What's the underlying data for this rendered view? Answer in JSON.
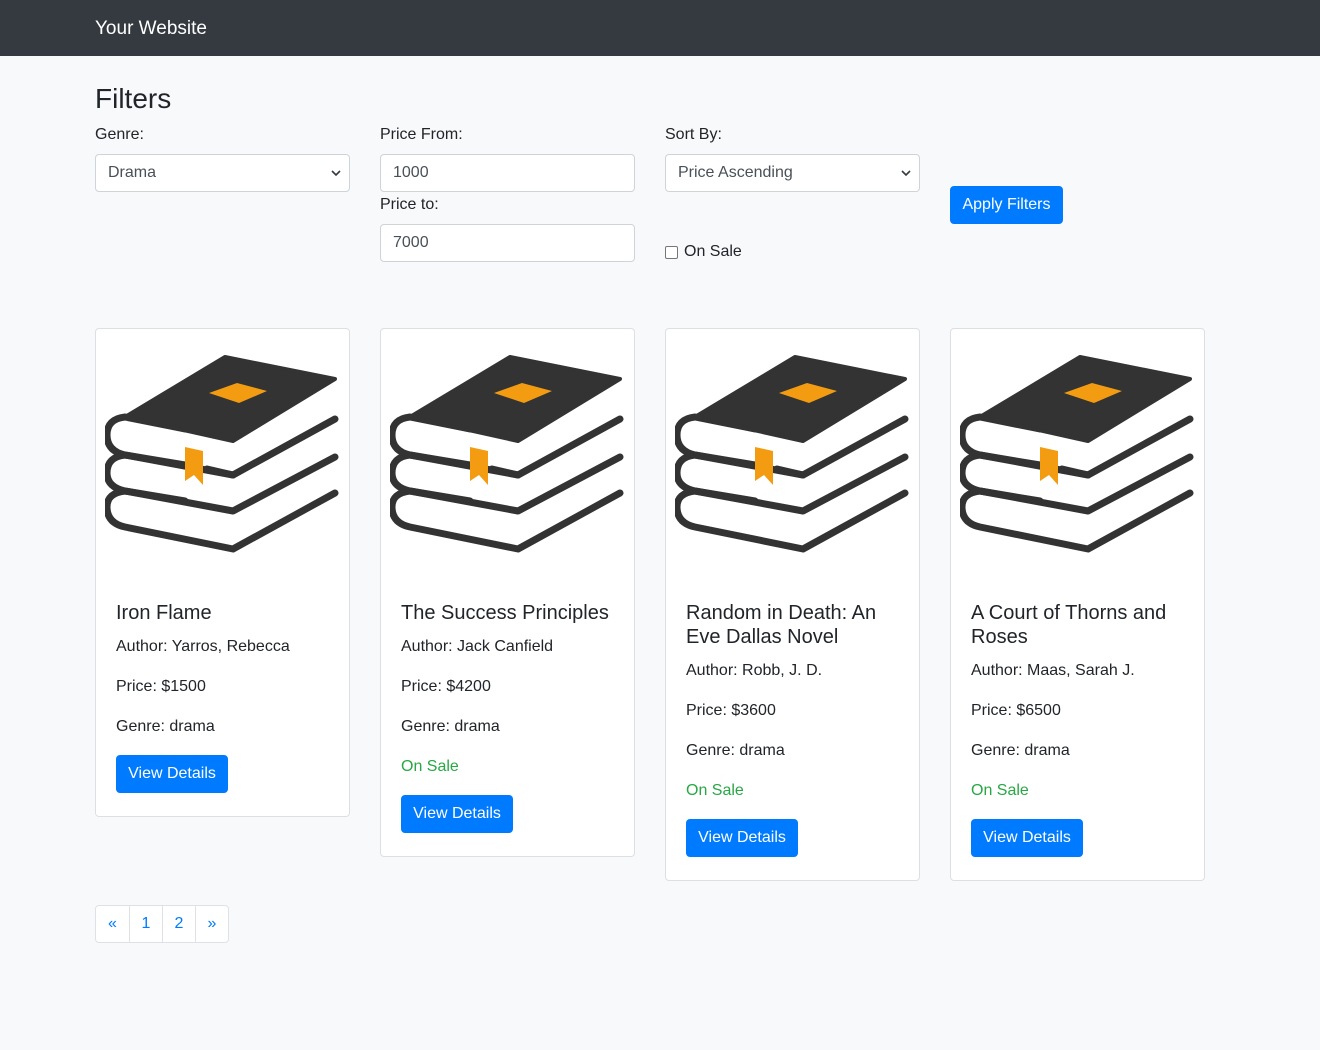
{
  "navbar": {
    "brand": "Your Website"
  },
  "filters": {
    "title": "Filters",
    "genre_label": "Genre:",
    "genre_value": "Drama",
    "price_from_label": "Price From:",
    "price_from_value": "1000",
    "price_to_label": "Price to:",
    "price_to_value": "7000",
    "sort_label": "Sort By:",
    "sort_value": "Price Ascending",
    "on_sale_label": "On Sale",
    "on_sale_checked": false,
    "apply_label": "Apply Filters"
  },
  "books": [
    {
      "title": "Iron Flame",
      "author": "Author: Yarros, Rebecca",
      "price": "Price: $1500",
      "genre": "Genre: drama",
      "on_sale": "",
      "button": "View Details"
    },
    {
      "title": "The Success Principles",
      "author": "Author: Jack Canfield",
      "price": "Price: $4200",
      "genre": "Genre: drama",
      "on_sale": "On Sale",
      "button": "View Details"
    },
    {
      "title": "Random in Death: An Eve Dallas Novel",
      "author": "Author: Robb, J. D.",
      "price": "Price: $3600",
      "genre": "Genre: drama",
      "on_sale": "On Sale",
      "button": "View Details"
    },
    {
      "title": "A Court of Thorns and Roses",
      "author": "Author: Maas, Sarah J.",
      "price": "Price: $6500",
      "genre": "Genre: drama",
      "on_sale": "On Sale",
      "button": "View Details"
    }
  ],
  "book_icon": "book-stack-icon",
  "pagination": {
    "prev": "«",
    "pages": [
      "1",
      "2"
    ],
    "next": "»"
  },
  "colors": {
    "navbar": "#343a40",
    "primary": "#007bff",
    "success": "#28a745",
    "book_dark": "#333333",
    "book_accent": "#f39c12"
  }
}
